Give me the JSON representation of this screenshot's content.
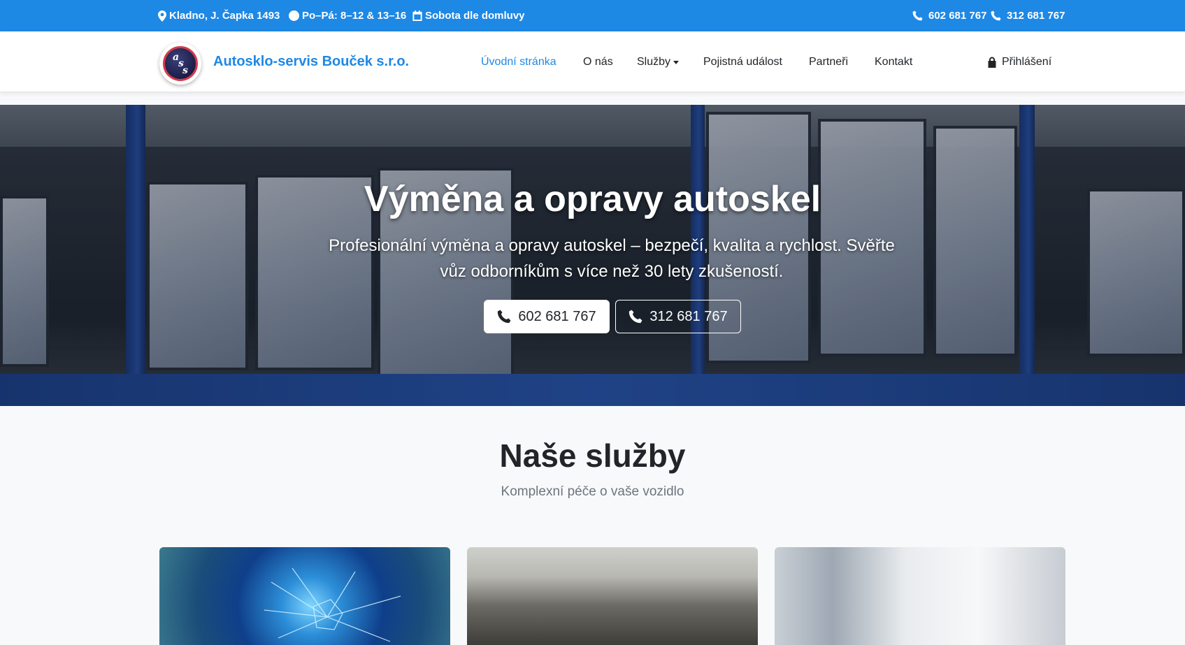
{
  "topbar": {
    "address": "Kladno, J. Čapka 1493",
    "hours": "Po–Pá: 8–12 & 13–16",
    "saturday": "Sobota dle domluvy",
    "phone1": "602 681 767",
    "phone2": "312 681 767"
  },
  "navbar": {
    "brand": "Autosklo-servis Bouček s.r.o.",
    "items": [
      "Úvodní stránka",
      "O nás",
      "Služby",
      "Pojistná událost",
      "Partneři",
      "Kontakt"
    ],
    "login": "Přihlášení"
  },
  "hero": {
    "title": "Výměna a opravy autoskel",
    "subtitle": "Profesionální výměna a opravy autoskel – bezpečí, kvalita a rychlost. Svěřte vůz odborníkům s více než 30 lety zkušeností.",
    "button1": "602 681 767",
    "button2": "312 681 767"
  },
  "services": {
    "title": "Naše služby",
    "subtitle": "Komplexní péče o vaše vozidlo"
  },
  "colors": {
    "accent": "#1e88e5"
  }
}
